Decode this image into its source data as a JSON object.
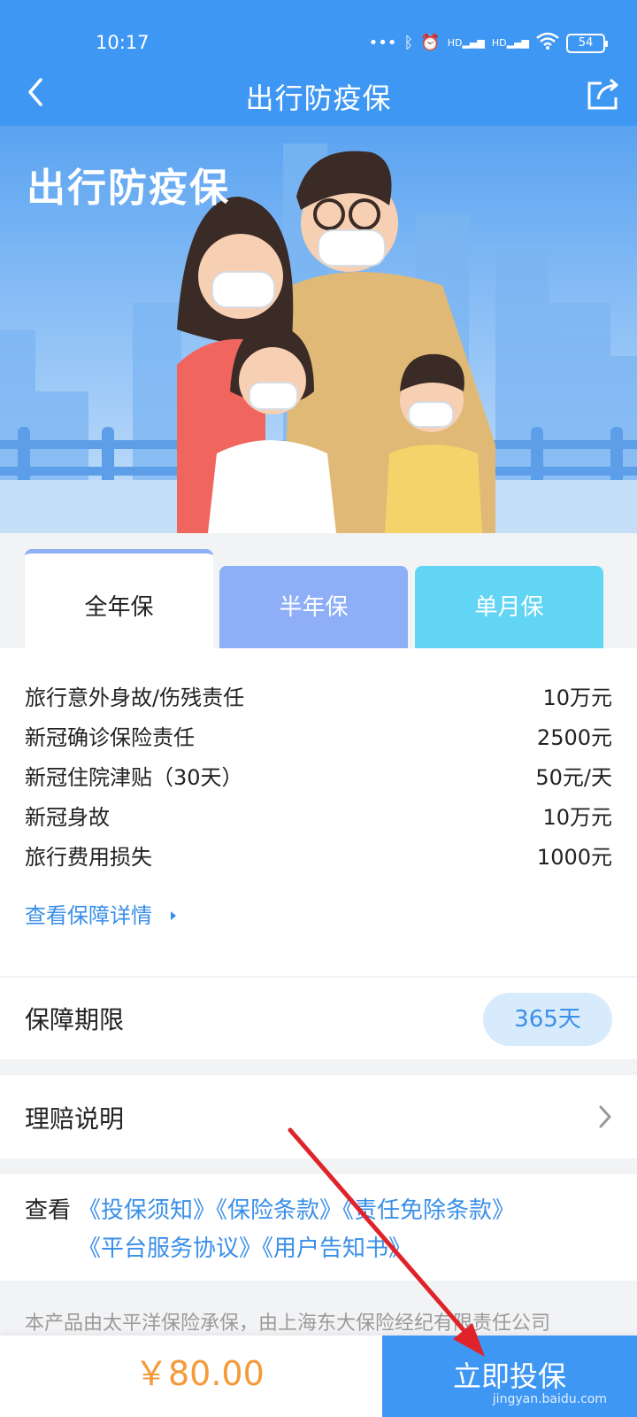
{
  "status_bar": {
    "time": "10:17",
    "signal_labels": [
      "HD",
      "HD"
    ],
    "battery": "54"
  },
  "header": {
    "title": "出行防疫保",
    "back_icon": "chevron-left-icon",
    "share_icon": "share-icon"
  },
  "hero": {
    "title": "出行防疫保"
  },
  "tabs": [
    {
      "label": "全年保",
      "active": true
    },
    {
      "label": "半年保",
      "active": false
    },
    {
      "label": "单月保",
      "active": false
    }
  ],
  "coverage": {
    "items": [
      {
        "name": "旅行意外身故/伤残责任",
        "amount": "10万元"
      },
      {
        "name": "新冠确诊保险责任",
        "amount": "2500元"
      },
      {
        "name": "新冠住院津贴（30天）",
        "amount": "50元/天"
      },
      {
        "name": "新冠身故",
        "amount": "10万元"
      },
      {
        "name": "旅行费用损失",
        "amount": "1000元"
      }
    ],
    "details_link": "查看保障详情"
  },
  "period": {
    "label": "保障期限",
    "value": "365天"
  },
  "claims": {
    "label": "理赔说明"
  },
  "docs": {
    "prefix": "查看",
    "links": [
      "《投保须知》",
      "《保险条款》",
      "《责任免除条款》",
      "《平台服务协议》",
      "《用户告知书》"
    ]
  },
  "disclaimer": "本产品由太平洋保险承保，由上海东大保险经纪有限责任公司",
  "bottom_bar": {
    "price": "￥80.00",
    "buy_label": "立即投保"
  },
  "watermark": {
    "text": "jingyan.baidu.com"
  },
  "colors": {
    "primary": "#3f97f4",
    "price": "#f49a3a",
    "link": "#3a8fe8",
    "annotation_arrow": "#e0232a"
  }
}
